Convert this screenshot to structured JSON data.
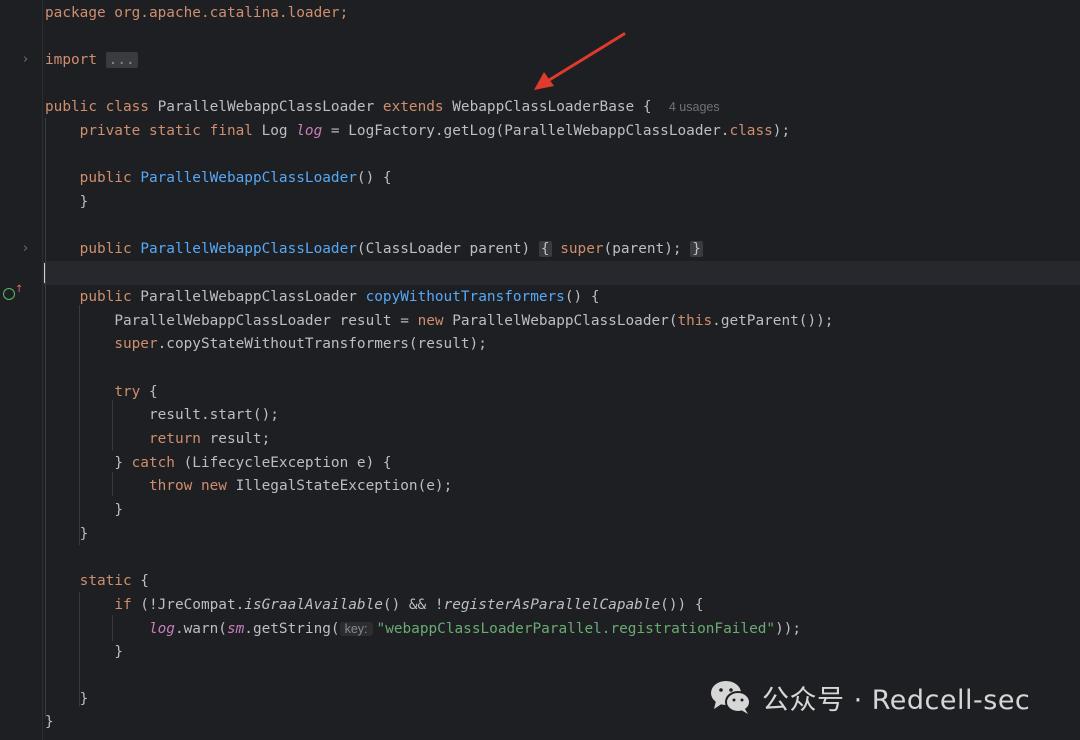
{
  "editor": {
    "file_kind": "Java source",
    "package_line": "package org.apache.catalina.loader;",
    "import_keyword": "import",
    "import_fold": "...",
    "class_decl": {
      "mods": "public class",
      "name": "ParallelWebappClassLoader",
      "extends_kw": "extends",
      "super_name": "WebappClassLoaderBase",
      "brace": "{",
      "usages_hint": "4 usages"
    },
    "log_field": {
      "mods": "private static final",
      "type": " Log ",
      "name": "log",
      "rest_a": " = LogFactory.getLog(ParallelWebappClassLoader.",
      "class_kw": "class",
      "rest_b": ");"
    },
    "ctor1": {
      "kw": "public",
      "name": "ParallelWebappClassLoader",
      "rest": "() {",
      "close": "}"
    },
    "ctor2": {
      "kw": "public",
      "name": "ParallelWebappClassLoader",
      "params": "(ClassLoader parent)",
      "open": "{",
      "super_kw": "super",
      "call": "(parent);",
      "close": "}"
    },
    "method": {
      "kw": "public",
      "ret": " ParallelWebappClassLoader ",
      "name": "copyWithoutTransformers",
      "rest": "() {",
      "l1_a": "ParallelWebappClassLoader result = ",
      "l1_new": "new",
      "l1_b": " ParallelWebappClassLoader(",
      "l1_this": "this",
      "l1_c": ".getParent());",
      "l2_super": "super",
      "l2_rest": ".copyStateWithoutTransformers(result);",
      "try_kw": "try",
      "try_brace": " {",
      "l3": "result.start();",
      "ret_kw": "return",
      "ret_rest": " result;",
      "catch_close": "} ",
      "catch_kw": "catch",
      "catch_rest": " (LifecycleException e) {",
      "throw_kw": "throw",
      "new_kw": "new",
      "throw_rest": " IllegalStateException(e);",
      "inner_close": "}",
      "close": "}"
    },
    "static_block": {
      "kw": "static",
      "brace": " {",
      "if_kw": "if",
      "if_a": " (!JreCompat.",
      "if_m1": "isGraalAvailable",
      "if_b": "() && !",
      "if_m2": "registerAsParallelCapable",
      "if_c": "()) {",
      "warn_field": "log",
      "warn_a": ".warn(",
      "warn_sm": "sm",
      "warn_b": ".getString(",
      "key_hint": "key:",
      "warn_str": "\"webappClassLoaderParallel.registrationFailed\"",
      "warn_c": "));",
      "if_close": "}",
      "close": "}"
    },
    "class_close": "}"
  },
  "watermark": {
    "text": "公众号 · Redcell-sec"
  },
  "colors": {
    "background": "#1e1f22",
    "keyword": "#cf8e6d",
    "method": "#56a8f5",
    "field": "#c77dbb",
    "string": "#6aab73",
    "arrow": "#e03a2f"
  },
  "icons": [
    "fold-arrow-icon",
    "implementation-icon",
    "red-arrow-annotation",
    "wechat-icon"
  ]
}
